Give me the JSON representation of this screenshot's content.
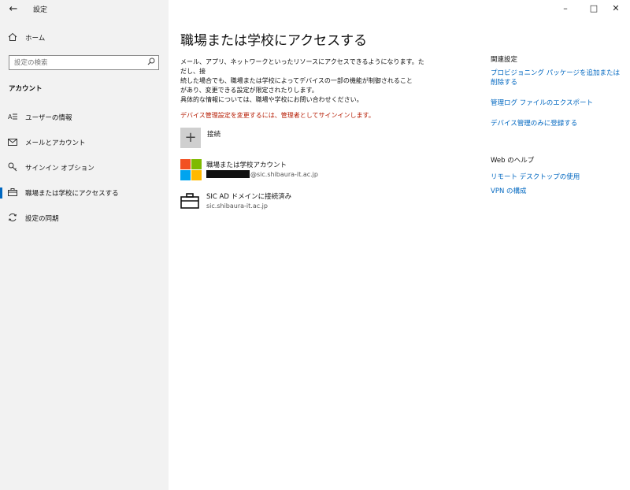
{
  "window": {
    "app_title": "設定",
    "back_icon": "arrow-left-icon",
    "controls": [
      "minimize-icon",
      "maximize-icon",
      "close-icon"
    ]
  },
  "sidebar": {
    "home": {
      "label": "ホーム",
      "icon": "home-icon"
    },
    "search": {
      "placeholder": "設定の検索",
      "icon": "search-icon"
    },
    "section_title": "アカウント",
    "items": [
      {
        "label": "ユーザーの情報",
        "icon": "person-info-icon",
        "active": false
      },
      {
        "label": "メールとアカウント",
        "icon": "mail-icon",
        "active": false
      },
      {
        "label": "サインイン オプション",
        "icon": "key-icon",
        "active": false
      },
      {
        "label": "職場または学校にアクセスする",
        "icon": "briefcase-icon",
        "active": true
      },
      {
        "label": "設定の同期",
        "icon": "sync-icon",
        "active": false
      }
    ]
  },
  "main": {
    "title": "職場または学校にアクセスする",
    "description_lines": [
      "メール、アプリ、ネットワークといったリソースにアクセスできるようになります。ただし、接",
      "続した場合でも、職場または学校によってデバイスの一部の機能が制御されること",
      "があり、変更できる設定が限定されたりします。",
      "具体的な情報については、職場や学校にお問い合わせください。"
    ],
    "warning": "デバイス管理設定を変更するには、管理者としてサインインします。",
    "connect_label": "接続",
    "accounts": [
      {
        "name": "職場または学校アカウント",
        "email_suffix": "@sic.shibaura-it.ac.jp"
      },
      {
        "name": "SIC AD ドメインに接続済み",
        "domain": "sic.shibaura-it.ac.jp"
      }
    ]
  },
  "related": {
    "heading": "関連設定",
    "links": [
      "プロビジョニング パッケージを追加または削除する",
      "管理ログ ファイルのエクスポート",
      "デバイス管理のみに登録する"
    ],
    "help_heading": "Web のヘルプ",
    "help_links": [
      "リモート デスクトップの使用",
      "VPN の構成"
    ]
  },
  "colors": {
    "accent": "#0067c0",
    "warning": "#b51a00",
    "sidebar_bg": "#f2f2f2"
  }
}
